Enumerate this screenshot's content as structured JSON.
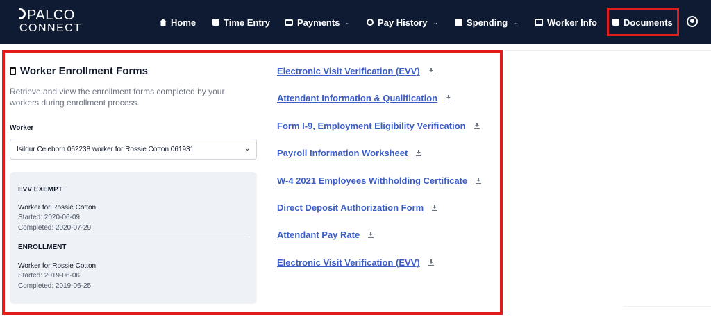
{
  "brand": {
    "line1": "PALCO",
    "line2": "CONNECT"
  },
  "nav": {
    "home": "Home",
    "time_entry": "Time Entry",
    "payments": "Payments",
    "pay_history": "Pay History",
    "spending": "Spending",
    "worker_info": "Worker Info",
    "documents": "Documents"
  },
  "panel": {
    "title": "Worker Enrollment Forms",
    "description": "Retrieve and view the enrollment forms completed by your workers during enrollment process.",
    "worker_label": "Worker",
    "worker_selected": "Isildur Celeborn 062238 worker for Rossie Cotton 061931"
  },
  "enrollments": [
    {
      "heading": "EVV EXEMPT",
      "title": "Worker for Rossie Cotton",
      "started": "Started: 2020-06-09",
      "completed": "Completed: 2020-07-29"
    },
    {
      "heading": "ENROLLMENT",
      "title": "Worker for Rossie Cotton",
      "started": "Started: 2019-06-06",
      "completed": "Completed: 2019-06-25"
    }
  ],
  "forms": [
    "Electronic Visit Verification (EVV)",
    "Attendant Information & Qualification",
    "Form I-9, Employment Eligibility Verification",
    "Payroll Information Worksheet",
    "W-4 2021 Employees Withholding Certificate",
    "Direct Deposit Authorization Form",
    "Attendant Pay Rate",
    "Electronic Visit Verification (EVV)"
  ],
  "colors": {
    "nav_bg": "#0f1a33",
    "link": "#3b5ec6",
    "highlight": "#e21b1b",
    "card_bg": "#eef1f6"
  },
  "icons": [
    "home-icon",
    "clock-icon",
    "payments-icon",
    "history-icon",
    "spending-icon",
    "worker-info-icon",
    "folder-icon",
    "account-icon",
    "book-icon",
    "download-icon",
    "chevron-down-icon"
  ]
}
